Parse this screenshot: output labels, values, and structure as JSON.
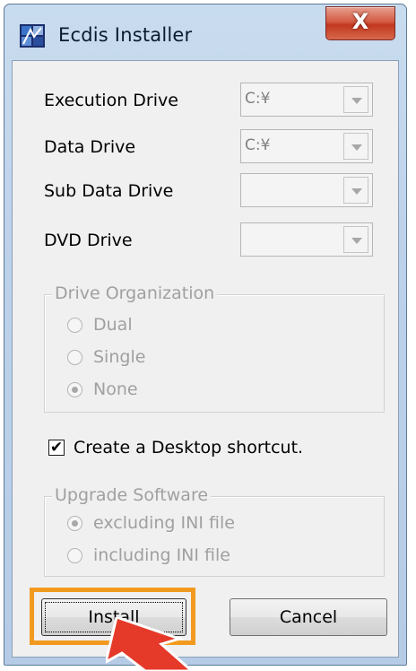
{
  "window": {
    "title": "Ecdis Installer",
    "close_label": "X"
  },
  "drives": [
    {
      "label": "Execution Drive",
      "value": "C:¥"
    },
    {
      "label": "Data Drive",
      "value": "C:¥"
    },
    {
      "label": "Sub Data Drive",
      "value": ""
    },
    {
      "label": "DVD Drive",
      "value": ""
    }
  ],
  "drive_organization": {
    "title": "Drive Organization",
    "options": [
      {
        "label": "Dual",
        "selected": false
      },
      {
        "label": "Single",
        "selected": false
      },
      {
        "label": "None",
        "selected": true
      }
    ]
  },
  "shortcut": {
    "label": "Create a Desktop shortcut.",
    "checked": true,
    "mark": "✔"
  },
  "upgrade": {
    "title": "Upgrade Software",
    "options": [
      {
        "label": "excluding INI file",
        "selected": true
      },
      {
        "label": "including INI file",
        "selected": false
      }
    ]
  },
  "buttons": {
    "install": "Install",
    "cancel": "Cancel"
  },
  "colors": {
    "highlight": "#f29a1f",
    "pointer": "#e53a2a",
    "close": "#c2381f"
  }
}
